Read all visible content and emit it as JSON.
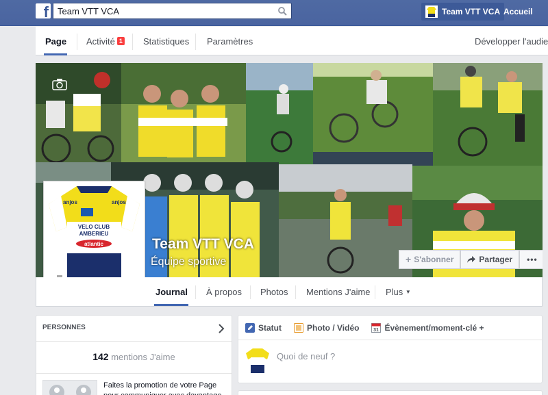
{
  "topbar": {
    "logo": "f",
    "search_value": "Team VTT VCA",
    "profile_name": "Team VTT VCA",
    "home_label": "Accueil"
  },
  "tabnav": {
    "page": "Page",
    "activity": "Activité",
    "activity_badge": "1",
    "stats": "Statistiques",
    "settings": "Paramètres",
    "audience": "Développer l'audien"
  },
  "page": {
    "name": "Team VTT VCA",
    "category": "Équipe sportive"
  },
  "cover_buttons": {
    "subscribe": "S'abonner",
    "share": "Partager",
    "more": "•••"
  },
  "pagebar": {
    "journal": "Journal",
    "about": "À propos",
    "photos": "Photos",
    "likes": "Mentions J'aime",
    "more": "Plus"
  },
  "people": {
    "header": "PERSONNES",
    "likes_count": "142",
    "likes_label": "mentions J'aime",
    "promo_text": "Faites la promotion de votre Page pour communiquer avec davantage"
  },
  "composer": {
    "status": "Statut",
    "photo_video": "Photo / Vidéo",
    "event": "Évènement/moment-clé +",
    "placeholder": "Quoi de neuf ?"
  },
  "colors": {
    "topbar": "#4e69a2",
    "accent": "#4267b2",
    "badge": "#fa3e3e",
    "jersey_yellow": "#f2dd1a",
    "jersey_navy": "#1b2f6b"
  }
}
